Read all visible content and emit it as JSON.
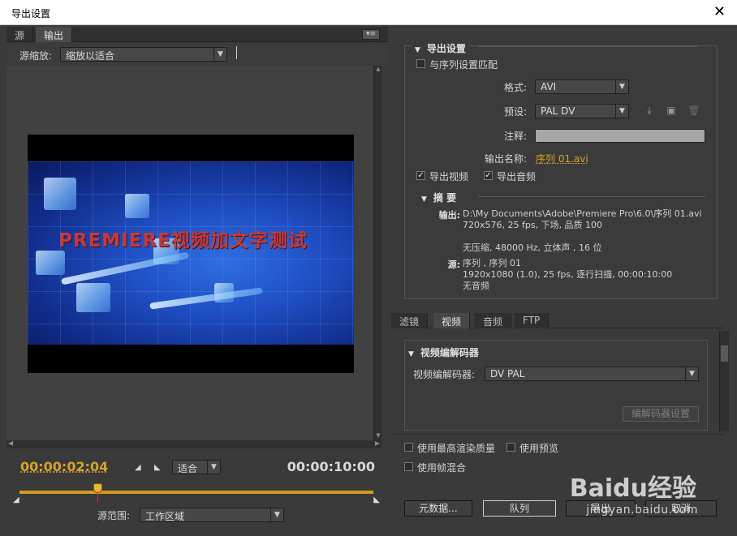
{
  "window": {
    "title": "导出设置"
  },
  "left_tabs": [
    "源",
    "输出"
  ],
  "source_scale": {
    "label": "源缩放:",
    "value": "缩放以适合"
  },
  "video_text": "PREMIERE视频加文字测试",
  "timecode_current": "00:00:02:04",
  "timecode_end": "00:00:10:00",
  "fit_select": "适合",
  "source_range": {
    "label": "源范围:",
    "value": "工作区域"
  },
  "export_settings": {
    "heading": "导出设置",
    "match_sequence": "与序列设置匹配",
    "format_label": "格式:",
    "format_value": "AVI",
    "preset_label": "预设:",
    "preset_value": "PAL DV",
    "comment_label": "注释:",
    "output_name_label": "输出名称:",
    "output_name": "序列 01.avi",
    "export_video": "导出视频",
    "export_audio": "导出音频"
  },
  "summary": {
    "heading": "摘 要",
    "output_key": "输出:",
    "output_lines": [
      "D:\\My Documents\\Adobe\\Premiere Pro\\6.0\\序列 01.avi",
      "720x576, 25 fps, 下场, 品质 100",
      "",
      "无压缩, 48000 Hz, 立体声 , 16 位"
    ],
    "source_key": "源:",
    "source_lines": [
      "序列 , 序列 01",
      "1920x1080 (1.0), 25 fps, 逐行扫描, 00:00:10:00",
      "无音频"
    ]
  },
  "right_tabs": [
    "滤镜",
    "视频",
    "音频",
    "FTP"
  ],
  "codec": {
    "heading": "视频编解码器",
    "label": "视频编解码器:",
    "value": "DV PAL",
    "settings_button": "编解码器设置"
  },
  "options": {
    "max_quality": "使用最高渲染质量",
    "use_preview": "使用预览",
    "frame_blend": "使用帧混合"
  },
  "buttons": {
    "metadata": "元数据...",
    "queue": "队列",
    "export": "导出",
    "cancel": "取消"
  },
  "watermark": {
    "brand": "Baidu经验",
    "url": "jingyan.baidu.com"
  }
}
